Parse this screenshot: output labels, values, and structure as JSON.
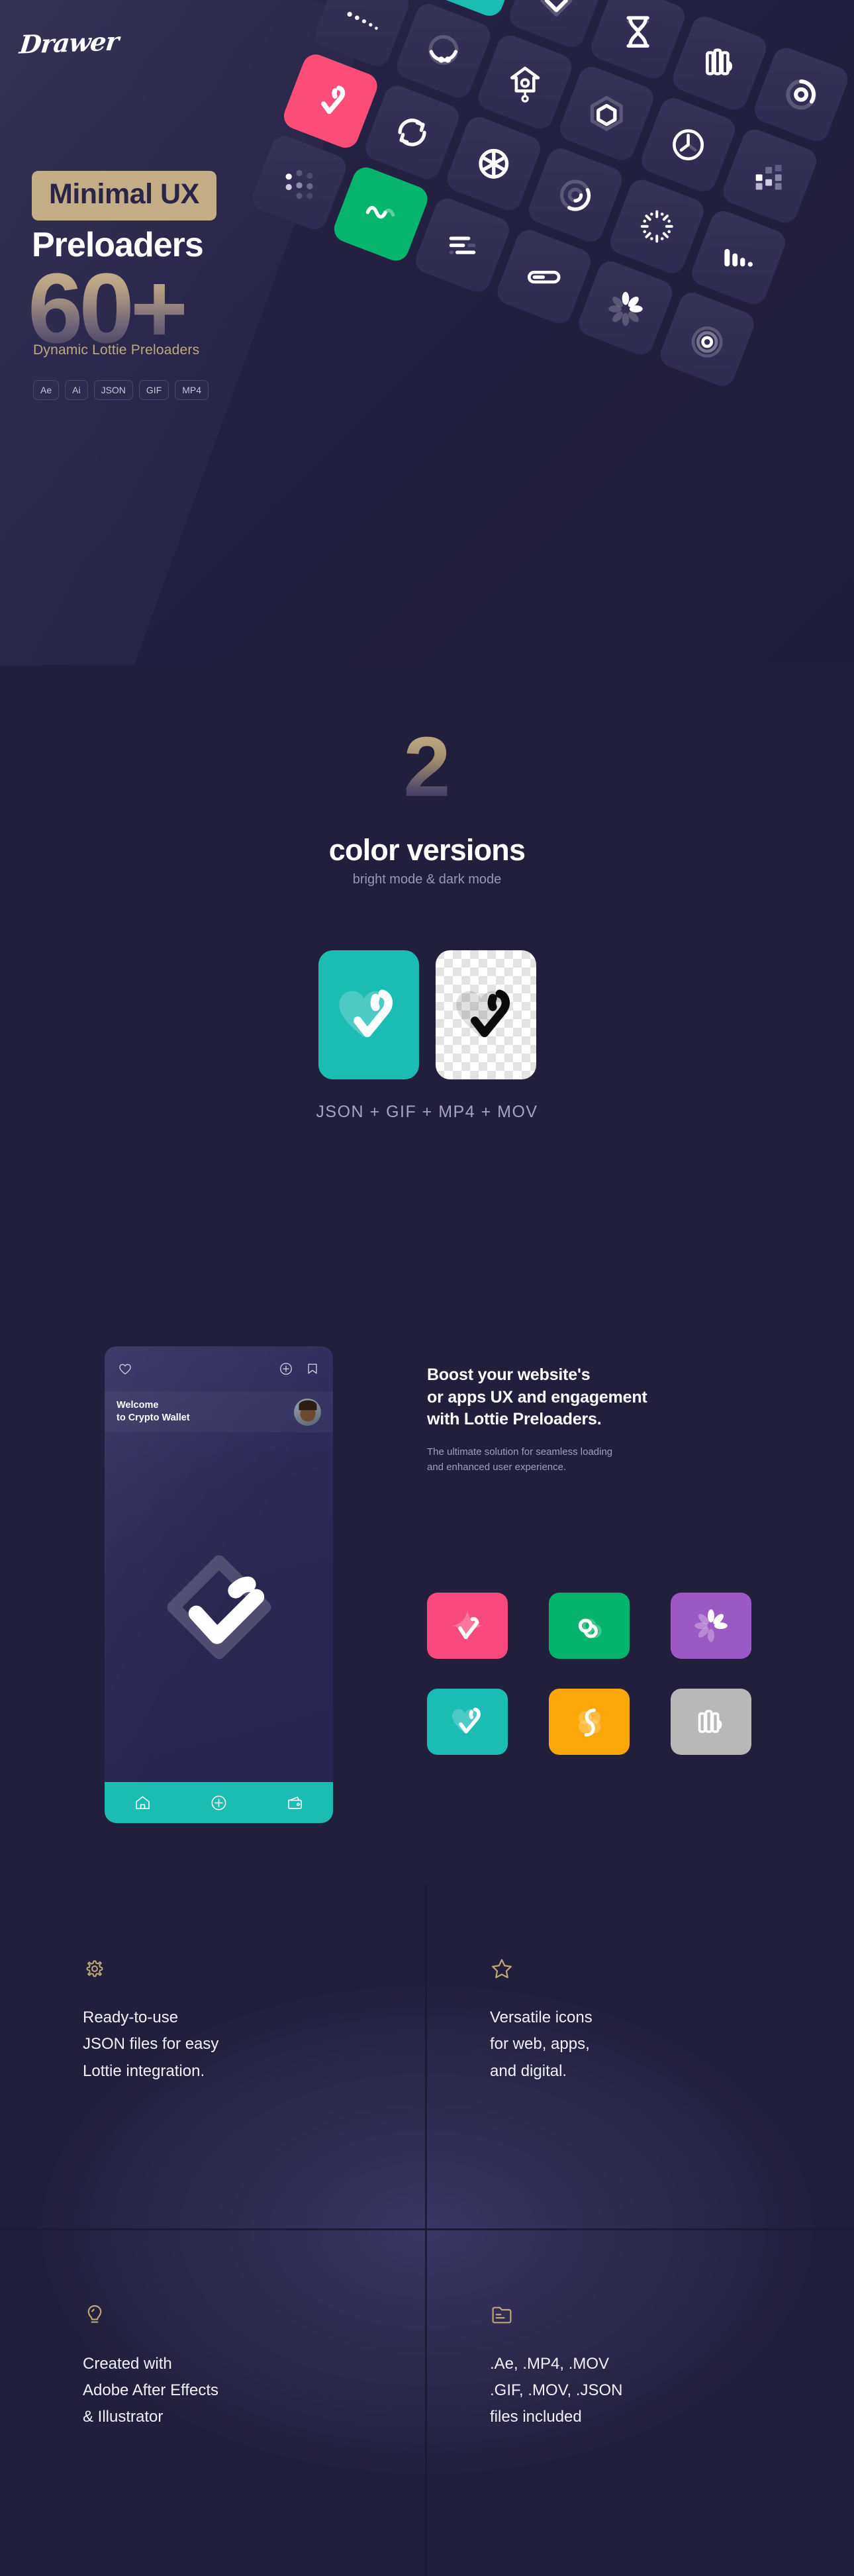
{
  "brand": {
    "logo": "Drawer"
  },
  "hero": {
    "badge": "Minimal UX",
    "title": "Preloaders",
    "count": "60+",
    "count_sub": "Dynamic Lottie Preloaders",
    "tags": [
      "Ae",
      "Ai",
      "JSON",
      "GIF",
      "MP4"
    ],
    "accent_gold": "#c2ad87",
    "bg": "#221f3c",
    "grid_icons": [
      {
        "name": "check-swoosh-icon",
        "color": "default"
      },
      {
        "name": "heart-loader-icon",
        "color": "teal"
      },
      {
        "name": "diamond-outline-icon",
        "color": "default"
      },
      {
        "name": "hourglass-icon",
        "color": "default"
      },
      {
        "name": "books-stack-icon",
        "color": "default"
      },
      {
        "name": "ring-progress-icon",
        "color": "default"
      },
      {
        "name": "dots-trail-icon",
        "color": "default"
      },
      {
        "name": "circle-balls-icon",
        "color": "default"
      },
      {
        "name": "birdhouse-clock-icon",
        "color": "default"
      },
      {
        "name": "hexagon-icon",
        "color": "default"
      },
      {
        "name": "clock-icon",
        "color": "default"
      },
      {
        "name": "squares-grid-icon",
        "color": "default"
      },
      {
        "name": "heart-filled-icon",
        "color": "pink"
      },
      {
        "name": "refresh-arrows-icon",
        "color": "default"
      },
      {
        "name": "aperture-icon",
        "color": "default"
      },
      {
        "name": "double-ring-icon",
        "color": "default"
      },
      {
        "name": "sparkle-burst-icon",
        "color": "default"
      },
      {
        "name": "bars-fade-icon",
        "color": "default"
      },
      {
        "name": "dots-matrix-icon",
        "color": "default"
      },
      {
        "name": "wave-line-icon",
        "color": "green"
      },
      {
        "name": "lines-list-icon",
        "color": "default"
      },
      {
        "name": "pill-progress-icon",
        "color": "default"
      },
      {
        "name": "flower-burst-icon",
        "color": "default"
      },
      {
        "name": "radar-circle-icon",
        "color": "default"
      }
    ]
  },
  "versions": {
    "number": "2",
    "title": "color versions",
    "subtitle": "bright mode & dark mode",
    "formats": "JSON + GIF + MP4 + MOV",
    "format_parts": [
      "JSON",
      "GIF",
      "MP4",
      "MOV"
    ],
    "swatch_bright_color": "#1bbcb3",
    "swatch_dark_label": "transparent-checkerboard"
  },
  "boost": {
    "heading": "Boost your website's\nor apps UX and engagement\nwith Lottie Preloaders.",
    "heading_lines": [
      "Boost your website's",
      "or apps UX and engagement",
      "with Lottie Preloaders."
    ],
    "paragraph_lines": [
      "The ultimate solution for seamless loading",
      "and enhanced user experience."
    ],
    "phone": {
      "welcome_line1": "Welcome",
      "welcome_line2": "to Crypto Wallet",
      "top_icons": [
        "heart-icon",
        "plus-circle-icon",
        "bookmark-icon"
      ],
      "nav_icons": [
        "home-icon",
        "plus-circle-icon",
        "wallet-icon"
      ],
      "nav_color": "#1bbcb3",
      "loader": "diamond-check-loader-icon"
    },
    "tiles": [
      {
        "name": "sparkle-icon",
        "color": "#f8497f"
      },
      {
        "name": "infinity-icon",
        "color": "#06b36c"
      },
      {
        "name": "flower-icon",
        "color": "#9b59c4"
      },
      {
        "name": "heart-icon",
        "color": "#1bbcb3"
      },
      {
        "name": "s-curve-icon",
        "color": "#fba70a"
      },
      {
        "name": "bars-icon",
        "color": "#b8b8b8"
      }
    ]
  },
  "features": [
    {
      "icon": "gear-icon",
      "lines": [
        "Ready-to-use",
        "JSON files for easy",
        "Lottie integration."
      ]
    },
    {
      "icon": "star-icon",
      "lines": [
        "Versatile icons",
        "for web, apps,",
        "and digital."
      ]
    },
    {
      "icon": "lightbulb-icon",
      "lines": [
        "Created with",
        "Adobe After Effects",
        "& Illustrator"
      ]
    },
    {
      "icon": "folder-icon",
      "lines": [
        ".Ae, .MP4, .MOV",
        ".GIF, .MOV, .JSON",
        "files included"
      ]
    }
  ]
}
